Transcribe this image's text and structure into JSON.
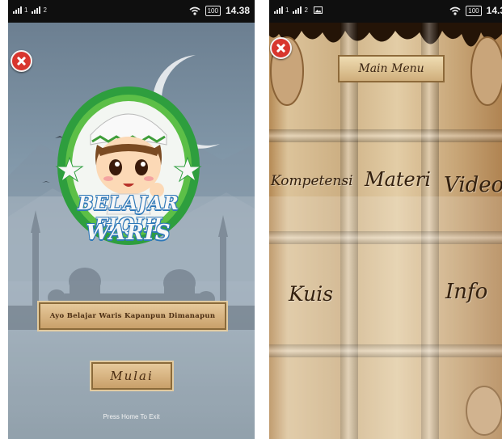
{
  "left_screen": {
    "status_bar": {
      "battery": "100",
      "time": "14.38"
    },
    "logo": {
      "line1": "BELAJAR FIQIH",
      "line2": "WARIS"
    },
    "tagline": "Ayo Belajar Waris Kapanpun Dimanapun",
    "start_button": "Mulai",
    "exit_hint": "Press Home To Exit"
  },
  "right_screen": {
    "status_bar": {
      "battery": "100",
      "time": "14.3"
    },
    "title": "Main Menu",
    "menu": {
      "kompetensi": "Kompetensi",
      "materi": "Materi",
      "video": "Video",
      "kuis": "Kuis",
      "info": "Info"
    }
  },
  "icons": {
    "close": "close-icon",
    "wifi": "wifi-icon",
    "signal": "signal-icon",
    "battery": "battery-icon",
    "gallery": "image-icon"
  },
  "colors": {
    "close_red": "#d8362e",
    "logo_green": "#2e9e3e",
    "parchment": "#d9bf93",
    "plaque": "#d6b885",
    "text_brown": "#3a2412"
  }
}
